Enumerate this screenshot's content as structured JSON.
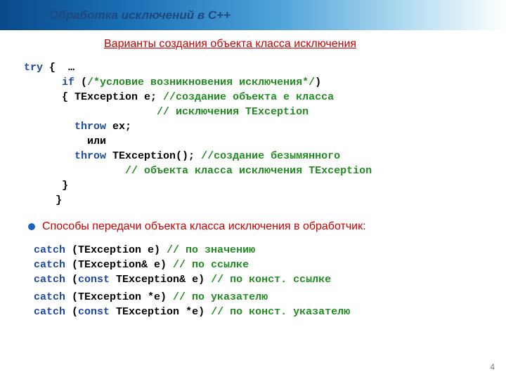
{
  "title": "Обработка исключений в С++",
  "subhead": " Варианты создания объекта класса исключения",
  "code": {
    "l1_try": "try",
    "l1_rest": " {  …",
    "l2_pad": "      ",
    "l2_if": "if",
    "l2_open": " (",
    "l2_cmt": "/*условие возникновения исключения*/",
    "l2_close": ")",
    "l3_pad": "      { TException e; ",
    "l3_cmt": "//создание объекта e класса",
    "l4_pad": "                     ",
    "l4_cmt": "// исключения TException",
    "l5_pad": "        ",
    "l5_throw": "throw",
    "l5_rest": " ex;",
    "l6_pad": "          или",
    "l7_pad": "        ",
    "l7_throw": "throw",
    "l7_rest": " TException(); ",
    "l7_cmt": "//создание безымянного",
    "l8_pad": "                ",
    "l8_cmt": "// объекта класса исключения TException",
    "l9": "      }",
    "l10": "     }"
  },
  "bullet": "Способы передачи объекта класса исключения в обработчик:",
  "catch": {
    "c1_kw": "catch",
    "c1_rest": " (TException e) ",
    "c1_cmt": "// по значению",
    "c2_kw": "catch",
    "c2_rest": " (TException& e) ",
    "c2_cmt": "// по ссылке",
    "c3_kw": "catch",
    "c3_open": " (",
    "c3_const": "const",
    "c3_rest": " TException& e) ",
    "c3_cmt": "// по конст. ссылке",
    "c4_kw": "catch",
    "c4_rest": " (TException *e) ",
    "c4_cmt": "// по указателю",
    "c5_kw": "catch",
    "c5_open": " (",
    "c5_const": "const",
    "c5_rest": " TException *e) ",
    "c5_cmt": "// по конст. указателю"
  },
  "page": "4"
}
